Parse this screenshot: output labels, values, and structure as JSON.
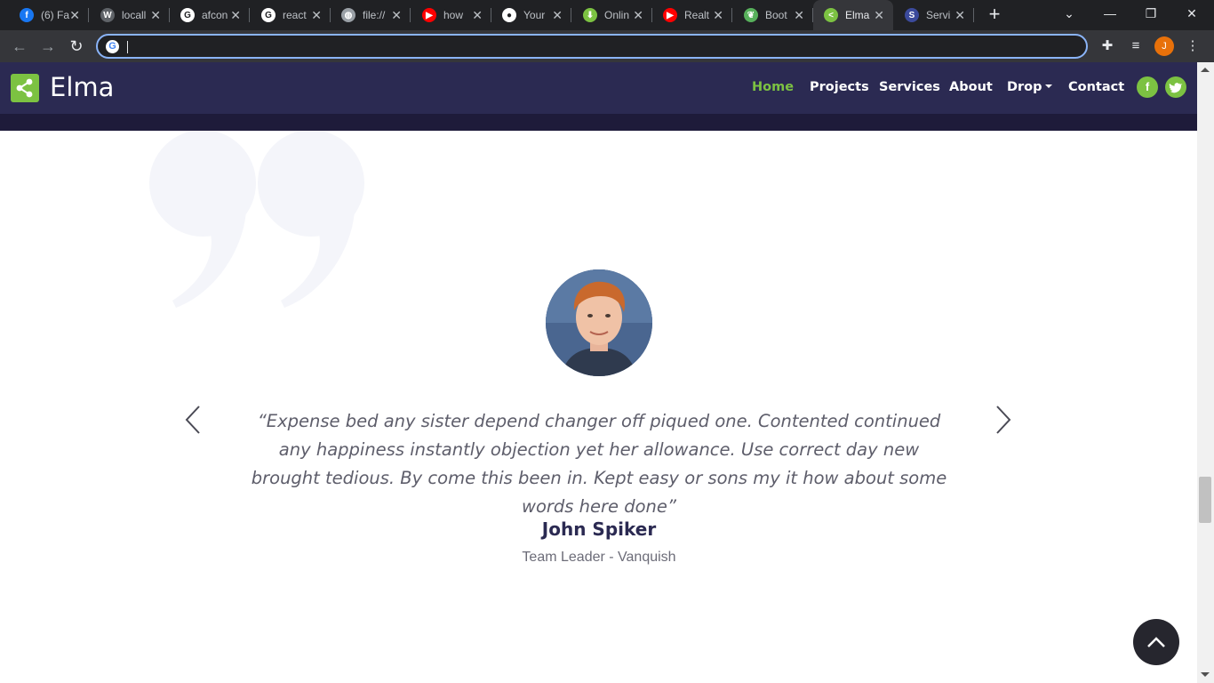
{
  "browser": {
    "tabs": [
      {
        "label": "(6) Fa",
        "favicon": "facebook-icon",
        "color": "#1877f2",
        "glyph": "f"
      },
      {
        "label": "locall",
        "favicon": "localhost-icon",
        "color": "#5f6368",
        "glyph": "W"
      },
      {
        "label": "afcon",
        "favicon": "google-icon",
        "color": "#ffffff",
        "glyph": "G"
      },
      {
        "label": "react",
        "favicon": "google-icon",
        "color": "#ffffff",
        "glyph": "G"
      },
      {
        "label": "file://",
        "favicon": "globe-icon",
        "color": "#9aa0a6",
        "glyph": "◍"
      },
      {
        "label": "how",
        "favicon": "youtube-icon",
        "color": "#ff0000",
        "glyph": "▶"
      },
      {
        "label": "Your",
        "favicon": "github-icon",
        "color": "#ffffff",
        "glyph": "●"
      },
      {
        "label": "Onlin",
        "favicon": "download-icon",
        "color": "#7cc242",
        "glyph": "⬇"
      },
      {
        "label": "Realt",
        "favicon": "youtube-icon",
        "color": "#ff0000",
        "glyph": "▶"
      },
      {
        "label": "Boot",
        "favicon": "bootstrap-leaf-icon",
        "color": "#57b05b",
        "glyph": "❦"
      },
      {
        "label": "Elma",
        "favicon": "share-icon",
        "color": "#7cc242",
        "glyph": "<"
      },
      {
        "label": "Servi",
        "favicon": "s-badge-icon",
        "color": "#3b4a9c",
        "glyph": "S"
      }
    ],
    "active_tab_index": 10,
    "address_value": "",
    "profile_initial": "J"
  },
  "site": {
    "brand": "Elma",
    "menu": [
      "Home",
      "Projects",
      "Services",
      "About",
      "Drop",
      "Contact"
    ],
    "active_menu": "Home",
    "accent_color": "#7cc242",
    "nav_color": "#2b2a52",
    "social": [
      "facebook-icon",
      "twitter-icon"
    ]
  },
  "testimonial": {
    "quote": "“Expense bed any sister depend changer off piqued one. Contented continued any happiness instantly objection yet her allowance. Use correct day new brought tedious. By come this been in. Kept easy or sons my it how about some words here done”",
    "author": "John Spiker",
    "role": "Team Leader - Vanquish"
  }
}
